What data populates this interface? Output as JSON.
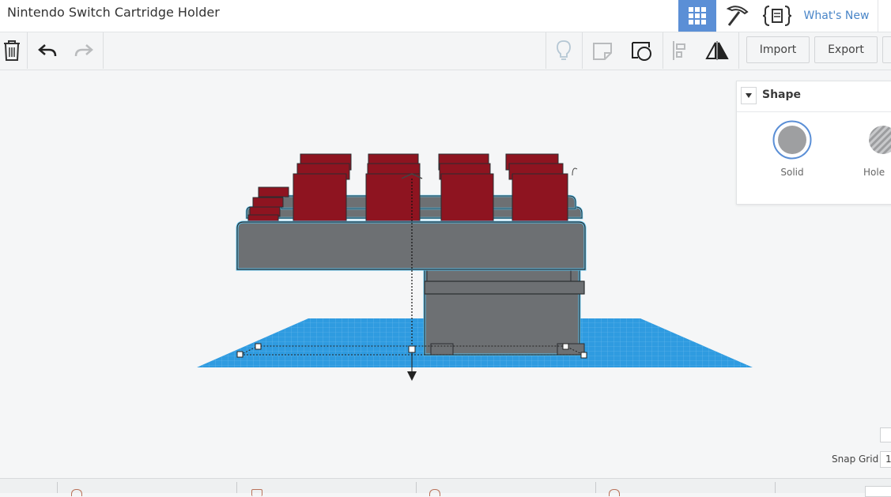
{
  "app": {
    "project_title": "Nintendo Switch Cartridge Holder"
  },
  "topnav": {
    "grid_icon": "grid-view-icon",
    "pickaxe_icon": "pickaxe-icon",
    "code_icon": "codeblocks-icon",
    "whats_new_label": "What's New"
  },
  "toolbar": {
    "icons": [
      "trash-icon",
      "undo-icon",
      "redo-icon",
      "lightbulb-icon",
      "note-icon",
      "workplane-icon",
      "align-icon",
      "mirror-icon"
    ],
    "import_label": "Import",
    "export_label": "Export"
  },
  "shape_panel": {
    "title": "Shape",
    "options": [
      {
        "label": "Solid",
        "selected": true,
        "color": "#9e9fa1"
      },
      {
        "label": "Hole",
        "selected": false
      }
    ]
  },
  "status": {
    "snap_grid_label": "Snap Grid",
    "snap_grid_value": "1"
  },
  "colors": {
    "accent": "#5b8fd6",
    "workplane": "#2f9be0",
    "cartridge": "#8e1420",
    "base": "#6d7073",
    "selection_outline": "#5fc6f0"
  }
}
